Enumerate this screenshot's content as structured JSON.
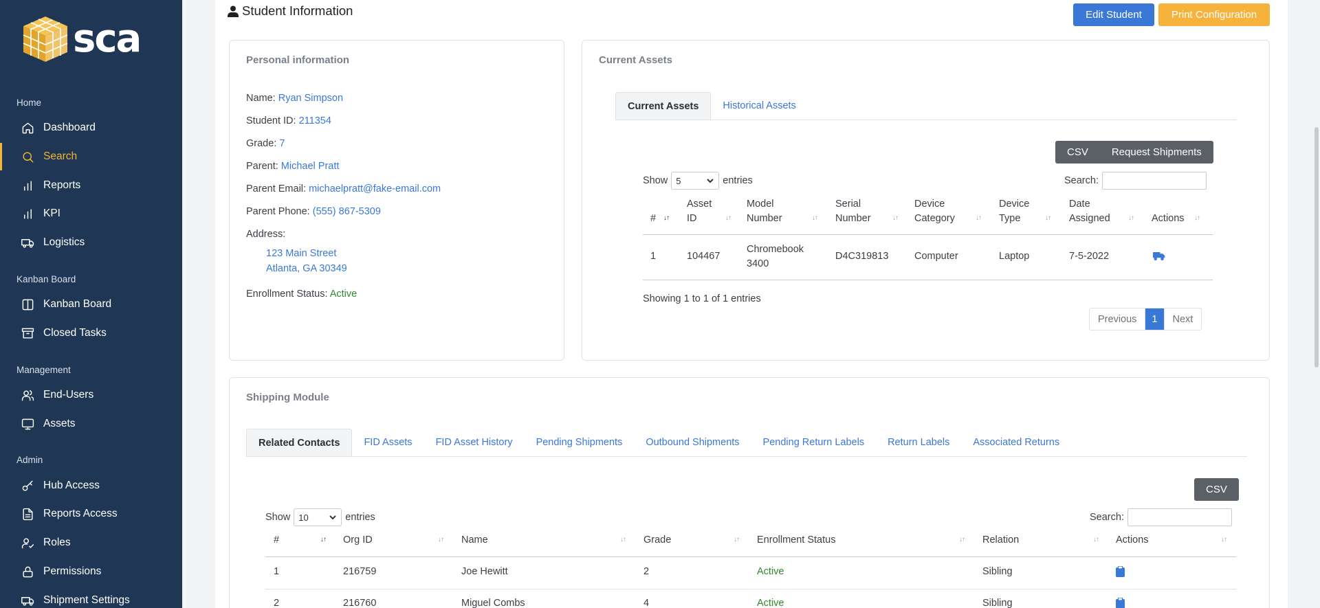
{
  "brand": {
    "logo_text": "sca"
  },
  "sidebar": {
    "sections": {
      "home": "Home",
      "kanban": "Kanban Board",
      "management": "Management",
      "admin": "Admin"
    },
    "items": [
      {
        "label": "Dashboard",
        "icon": "home-icon"
      },
      {
        "label": "Search",
        "icon": "search-icon",
        "active": true
      },
      {
        "label": "Reports",
        "icon": "bar-chart-icon"
      },
      {
        "label": "KPI",
        "icon": "bar-chart-icon"
      },
      {
        "label": "Logistics",
        "icon": "truck-icon"
      },
      {
        "label": "Kanban Board",
        "icon": "columns-icon"
      },
      {
        "label": "Closed Tasks",
        "icon": "archive-icon"
      },
      {
        "label": "End-Users",
        "icon": "users-icon"
      },
      {
        "label": "Assets",
        "icon": "monitor-icon"
      },
      {
        "label": "Hub Access",
        "icon": "key-icon"
      },
      {
        "label": "Reports Access",
        "icon": "file-icon"
      },
      {
        "label": "Roles",
        "icon": "user-check-icon"
      },
      {
        "label": "Permissions",
        "icon": "lock-icon"
      },
      {
        "label": "Shipment Settings",
        "icon": "truck-icon"
      }
    ]
  },
  "header": {
    "title": "Student Information",
    "edit_button": "Edit Student",
    "print_button": "Print Configuration"
  },
  "personal": {
    "title": "Personal information",
    "name_label": "Name:",
    "name": "Ryan Simpson",
    "id_label": "Student ID:",
    "id": "211354",
    "grade_label": "Grade:",
    "grade": "7",
    "parent_label": "Parent:",
    "parent": "Michael Pratt",
    "email_label": "Parent Email:",
    "email": "michaelpratt@fake-email.com",
    "phone_label": "Parent Phone:",
    "phone": "(555) 867-5309",
    "address_label": "Address:",
    "address_line1": "123 Main Street",
    "address_line2": "Atlanta, GA 30349",
    "enrollment_label": "Enrollment Status:",
    "enrollment": "Active"
  },
  "assets": {
    "title": "Current Assets",
    "tabs": [
      "Current Assets",
      "Historical Assets"
    ],
    "csv": "CSV",
    "request": "Request Shipments",
    "show": "Show",
    "entries_value": "5",
    "entries": "entries",
    "search_label": "Search:",
    "columns": [
      [
        "#"
      ],
      [
        "Asset",
        "ID"
      ],
      [
        "Model",
        "Number"
      ],
      [
        "Serial",
        "Number"
      ],
      [
        "Device",
        "Category"
      ],
      [
        "Device",
        "Type"
      ],
      [
        "Date",
        "Assigned"
      ],
      [
        "Actions"
      ]
    ],
    "rows": [
      {
        "num": "1",
        "asset_id": "104467",
        "model_1": "Chromebook",
        "model_2": "3400",
        "serial": "D4C319813",
        "category": "Computer",
        "type": "Laptop",
        "date": "7-5-2022",
        "action_icon": "truck-icon"
      }
    ],
    "info": "Showing 1 to 1 of 1 entries",
    "pager": {
      "prev": "Previous",
      "page": "1",
      "next": "Next"
    }
  },
  "shipping": {
    "title": "Shipping Module",
    "tabs": [
      "Related Contacts",
      "FID Assets",
      "FID Asset History",
      "Pending Shipments",
      "Outbound Shipments",
      "Pending Return Labels",
      "Return Labels",
      "Associated Returns"
    ],
    "csv": "CSV",
    "show": "Show",
    "entries_value": "10",
    "entries": "entries",
    "search_label": "Search:",
    "columns": [
      "#",
      "Org ID",
      "Name",
      "Grade",
      "Enrollment Status",
      "Relation",
      "Actions"
    ],
    "rows": [
      {
        "num": "1",
        "org_id": "216759",
        "name": "Joe Hewitt",
        "grade": "2",
        "status": "Active",
        "relation": "Sibling",
        "action_icon": "clipboard-icon"
      },
      {
        "num": "2",
        "org_id": "216760",
        "name": "Miguel Combs",
        "grade": "4",
        "status": "Active",
        "relation": "Sibling",
        "action_icon": "clipboard-icon"
      }
    ]
  },
  "colors": {
    "sidebar": "#1f3655",
    "accent": "#f2b632",
    "primary": "#3a78d8",
    "warning": "#f7b23b",
    "success": "#2e8a2e"
  }
}
